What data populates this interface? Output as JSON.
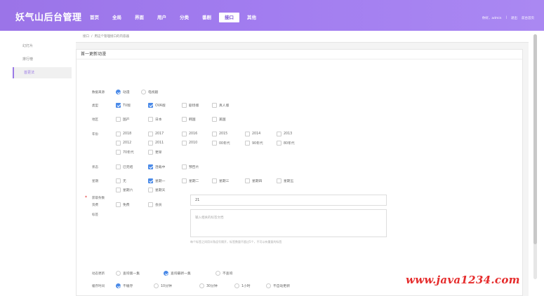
{
  "app": {
    "logo": "妖气山后台管理"
  },
  "nav": [
    {
      "label": "首页",
      "active": false
    },
    {
      "label": "全局",
      "active": false
    },
    {
      "label": "界面",
      "active": false
    },
    {
      "label": "用户",
      "active": false
    },
    {
      "label": "分类",
      "active": false
    },
    {
      "label": "番剧",
      "active": false
    },
    {
      "label": "接口",
      "active": true
    },
    {
      "label": "其他",
      "active": false
    }
  ],
  "user": {
    "greeting": "你好，admin",
    "sep": "|",
    "logout": "退出",
    "home": "前台首页"
  },
  "sidebar": [
    {
      "label": "幻灯片",
      "active": false
    },
    {
      "label": "排行榜",
      "active": false
    },
    {
      "label": "首更法",
      "active": true
    }
  ],
  "breadcrumb": {
    "home": "接口",
    "sep": "/",
    "page": "用这个管理接口的内容器"
  },
  "card": {
    "title": "首一更新动漫"
  },
  "form": {
    "source": {
      "label": "数据来源",
      "options": [
        {
          "text": "动漫",
          "on": true
        },
        {
          "text": "电视剧",
          "on": false
        }
      ]
    },
    "type": {
      "label": "类型",
      "options": [
        {
          "text": "TV版",
          "on": true
        },
        {
          "text": "OVA版",
          "on": true
        },
        {
          "text": "剧场版",
          "on": false
        },
        {
          "text": "真人版",
          "on": false
        }
      ]
    },
    "region": {
      "label": "地区",
      "options": [
        {
          "text": "国产",
          "on": false
        },
        {
          "text": "日本",
          "on": false
        },
        {
          "text": "韩国",
          "on": false
        },
        {
          "text": "美国",
          "on": false
        }
      ]
    },
    "year": {
      "label": "年份",
      "options": [
        {
          "text": "2018",
          "on": false
        },
        {
          "text": "2017",
          "on": false
        },
        {
          "text": "2016",
          "on": false
        },
        {
          "text": "2015",
          "on": false
        },
        {
          "text": "2014",
          "on": false
        },
        {
          "text": "2013",
          "on": false
        },
        {
          "text": "2012",
          "on": false
        },
        {
          "text": "2011",
          "on": false
        },
        {
          "text": "2010",
          "on": false
        },
        {
          "text": "00年代",
          "on": false
        },
        {
          "text": "90年代",
          "on": false
        },
        {
          "text": "80年代",
          "on": false
        },
        {
          "text": "70年代",
          "on": false
        },
        {
          "text": "更早",
          "on": false
        }
      ]
    },
    "status": {
      "label": "状态",
      "options": [
        {
          "text": "已完结",
          "on": false
        },
        {
          "text": "连载中",
          "on": true
        },
        {
          "text": "预告片",
          "on": false
        }
      ]
    },
    "weekday": {
      "label": "星期",
      "options": [
        {
          "text": "无",
          "on": false
        },
        {
          "text": "星期一",
          "on": true
        },
        {
          "text": "星期二",
          "on": false
        },
        {
          "text": "星期三",
          "on": false
        },
        {
          "text": "星期四",
          "on": false
        },
        {
          "text": "星期五",
          "on": false
        },
        {
          "text": "星期六",
          "on": false
        },
        {
          "text": "星期天",
          "on": false
        }
      ]
    },
    "fee": {
      "label": "资费",
      "options": [
        {
          "text": "免费",
          "on": false
        },
        {
          "text": "会员",
          "on": false
        }
      ]
    },
    "count": {
      "label": "获取条数",
      "value": "21"
    },
    "tags": {
      "label": "标签",
      "placeholder": "输入相关的标签文档",
      "hint": "每个标签之间用半角逗号隔开，标签数量不超过5个，不可以有重复的标签"
    },
    "update": {
      "label": "动态更新",
      "options": [
        {
          "text": "查询第一集",
          "on": false
        },
        {
          "text": "查询最新一集",
          "on": true
        },
        {
          "text": "不查询",
          "on": false
        }
      ]
    },
    "cache": {
      "label": "缓存时间",
      "options": [
        {
          "text": "不缓存",
          "on": true
        },
        {
          "text": "10分钟",
          "on": false
        },
        {
          "text": "30分钟",
          "on": false
        },
        {
          "text": "1小时",
          "on": false
        },
        {
          "text": "不自动更新",
          "on": false
        }
      ]
    }
  },
  "watermark": "www.java1234.com",
  "colors": {
    "header": "#9b74e8",
    "accent": "#4a8ae8",
    "watermark": "#e52b2b"
  }
}
